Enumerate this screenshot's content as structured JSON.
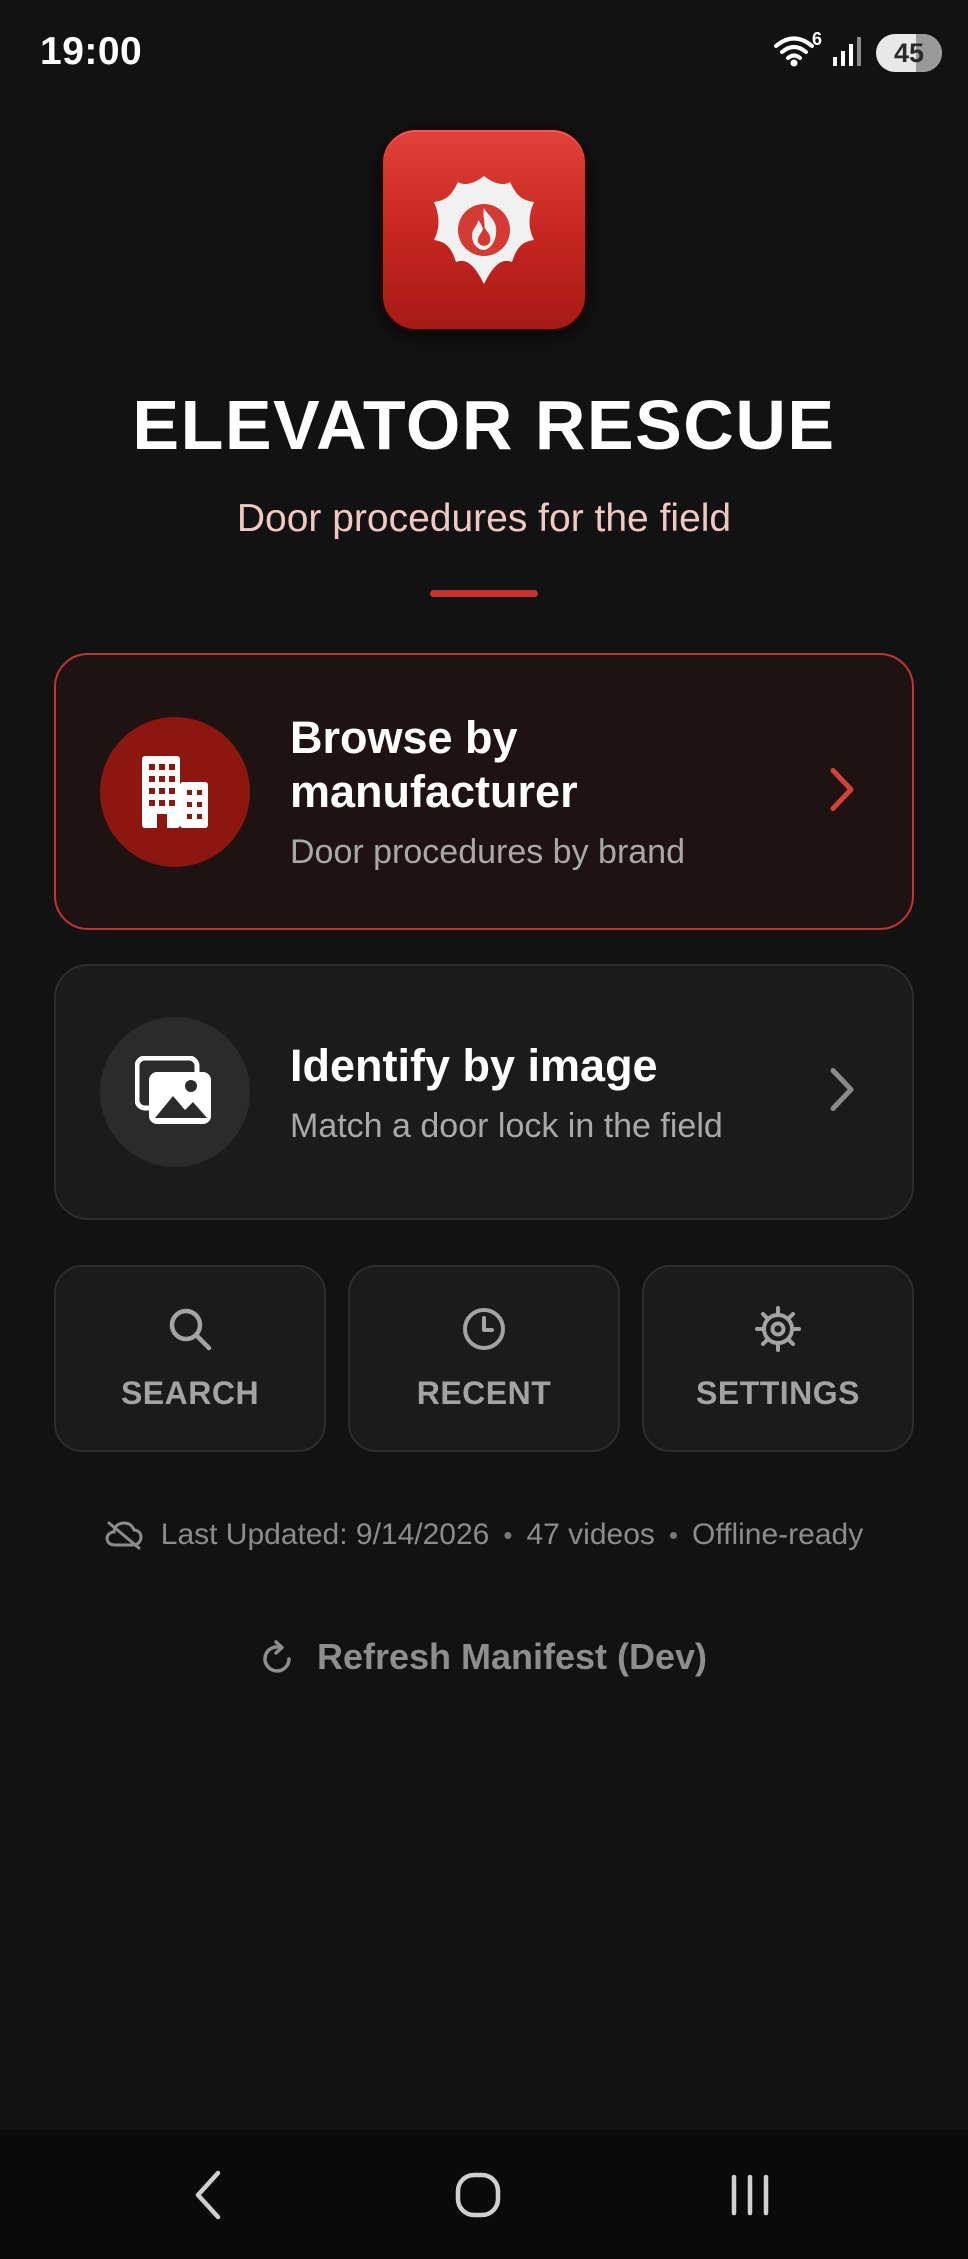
{
  "status_bar": {
    "time": "19:00",
    "wifi_badge": "6",
    "battery": "45",
    "icons": [
      "wifi-icon",
      "signal-icon",
      "battery-icon"
    ]
  },
  "header": {
    "app_title": "ELEVATOR RESCUE",
    "subtitle": "Door procedures for the field",
    "logo_icon": "fire-department-maltese-cross-icon"
  },
  "cards": {
    "browse": {
      "title": "Browse by manufacturer",
      "description": "Door procedures by brand",
      "icon": "building-icon"
    },
    "identify": {
      "title": "Identify by image",
      "description": "Match a door lock in the field",
      "icon": "images-icon"
    }
  },
  "quick_actions": {
    "search": "SEARCH",
    "recent": "RECENT",
    "settings": "SETTINGS"
  },
  "meta": {
    "last_updated": "Last Updated: 9/14/2026",
    "separator": "•",
    "videos": "47 videos",
    "offline": "Offline-ready"
  },
  "refresh": {
    "label": "Refresh Manifest (Dev)"
  },
  "colors": {
    "background": "#121212",
    "accent": "#c9312b",
    "browse_card_bg": "#1f1212",
    "card_bg": "#1b1b1b"
  }
}
